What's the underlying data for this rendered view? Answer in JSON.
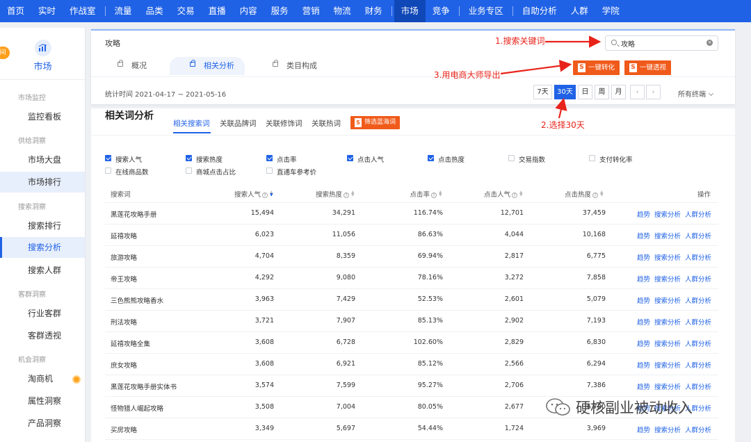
{
  "nav": {
    "items": [
      {
        "label": "首页",
        "dot": false
      },
      {
        "label": "实时",
        "dot": false
      },
      {
        "label": "作战室",
        "dot": true
      },
      {
        "sep": true
      },
      {
        "label": "流量",
        "dot": false
      },
      {
        "label": "品类",
        "dot": false
      },
      {
        "label": "交易",
        "dot": false
      },
      {
        "label": "直播",
        "dot": true
      },
      {
        "label": "内容",
        "dot": false
      },
      {
        "label": "服务",
        "dot": false
      },
      {
        "label": "营销",
        "dot": false
      },
      {
        "label": "物流",
        "dot": false
      },
      {
        "label": "财务",
        "dot": false
      },
      {
        "sep": true
      },
      {
        "label": "市场",
        "dot": false,
        "active": true
      },
      {
        "label": "竞争",
        "dot": false
      },
      {
        "sep": true
      },
      {
        "label": "业务专区",
        "dot": false
      },
      {
        "sep": true
      },
      {
        "label": "自助分析",
        "dot": false
      },
      {
        "label": "人群",
        "dot": false
      },
      {
        "label": "学院",
        "dot": false
      }
    ]
  },
  "sidebar": {
    "badge": "间",
    "title": "市场",
    "groups": [
      "市场监控",
      "供给洞察",
      "搜索洞察",
      "客群洞察",
      "机会洞察"
    ],
    "items": [
      "监控看板",
      "市场大盘",
      "市场排行",
      "搜索排行",
      "搜索分析",
      "搜索人群",
      "行业客群",
      "客群透视",
      "淘商机",
      "属性洞察",
      "产品洞察"
    ]
  },
  "header": {
    "breadcrumb": "攻略",
    "tabs": [
      "概况",
      "相关分析",
      "类目构成"
    ],
    "search_value": "攻略",
    "btn_convert": "一键转化",
    "btn_perspective": "一键透视",
    "stat_time": "统计时间 2021-04-17 ~ 2021-05-16",
    "date_buttons": [
      "7天",
      "30天",
      "日",
      "周",
      "月"
    ],
    "terminal": "所有终端"
  },
  "main": {
    "title": "相关词分析",
    "subtabs": [
      "相关搜索词",
      "关联品牌词",
      "关联修饰词",
      "关联热词"
    ],
    "filter_btn": "筛选蓝海词",
    "checkboxes": [
      {
        "label": "搜索人气",
        "checked": true
      },
      {
        "label": "搜索热度",
        "checked": true
      },
      {
        "label": "点击率",
        "checked": true
      },
      {
        "label": "点击人气",
        "checked": true
      },
      {
        "label": "点击热度",
        "checked": true
      },
      {
        "label": "交易指数",
        "checked": false
      },
      {
        "label": "支付转化率",
        "checked": false
      },
      {
        "label": "在线商品数",
        "checked": false
      },
      {
        "label": "商城点击占比",
        "checked": false
      },
      {
        "label": "直通车参考价",
        "checked": false
      }
    ],
    "columns": [
      "搜索词",
      "搜索人气",
      "搜索热度",
      "点击率",
      "点击人气",
      "点击热度",
      "操作"
    ],
    "ops": [
      "趋势",
      "搜索分析",
      "人群分析"
    ],
    "rows": [
      [
        "黑莲花攻略手册",
        "15,494",
        "34,291",
        "116.74%",
        "12,701",
        "37,459"
      ],
      [
        "延禧攻略",
        "6,023",
        "11,056",
        "86.63%",
        "4,044",
        "10,168"
      ],
      [
        "旅游攻略",
        "4,704",
        "8,359",
        "69.94%",
        "2,817",
        "6,775"
      ],
      [
        "帝王攻略",
        "4,292",
        "9,080",
        "78.16%",
        "3,272",
        "7,858"
      ],
      [
        "三色熊熊攻略香水",
        "3,963",
        "7,429",
        "52.53%",
        "2,601",
        "5,079"
      ],
      [
        "刑法攻略",
        "3,721",
        "7,907",
        "85.13%",
        "2,902",
        "7,193"
      ],
      [
        "延禧攻略全集",
        "3,608",
        "6,728",
        "102.60%",
        "2,829",
        "6,830"
      ],
      [
        "庶女攻略",
        "3,608",
        "6,921",
        "85.12%",
        "2,566",
        "6,294"
      ],
      [
        "黑莲花攻略手册实体书",
        "3,574",
        "7,599",
        "95.27%",
        "2,706",
        "7,386"
      ],
      [
        "怪物猎人崛起攻略",
        "3,508",
        "7,004",
        "80.05%",
        "2,677",
        "6,720"
      ],
      [
        "买房攻略",
        "3,349",
        "5,697",
        "54.44%",
        "1,724",
        "3,969"
      ]
    ]
  },
  "annotations": {
    "a1": "1.搜索关键词",
    "a2": "2.选择30天",
    "a3": "3.用电商大师导出"
  },
  "watermark": "硬核副业被动收入",
  "colors": {
    "primary": "#2062e6",
    "orange": "#f05a1a",
    "annotation": "#e8231a"
  }
}
